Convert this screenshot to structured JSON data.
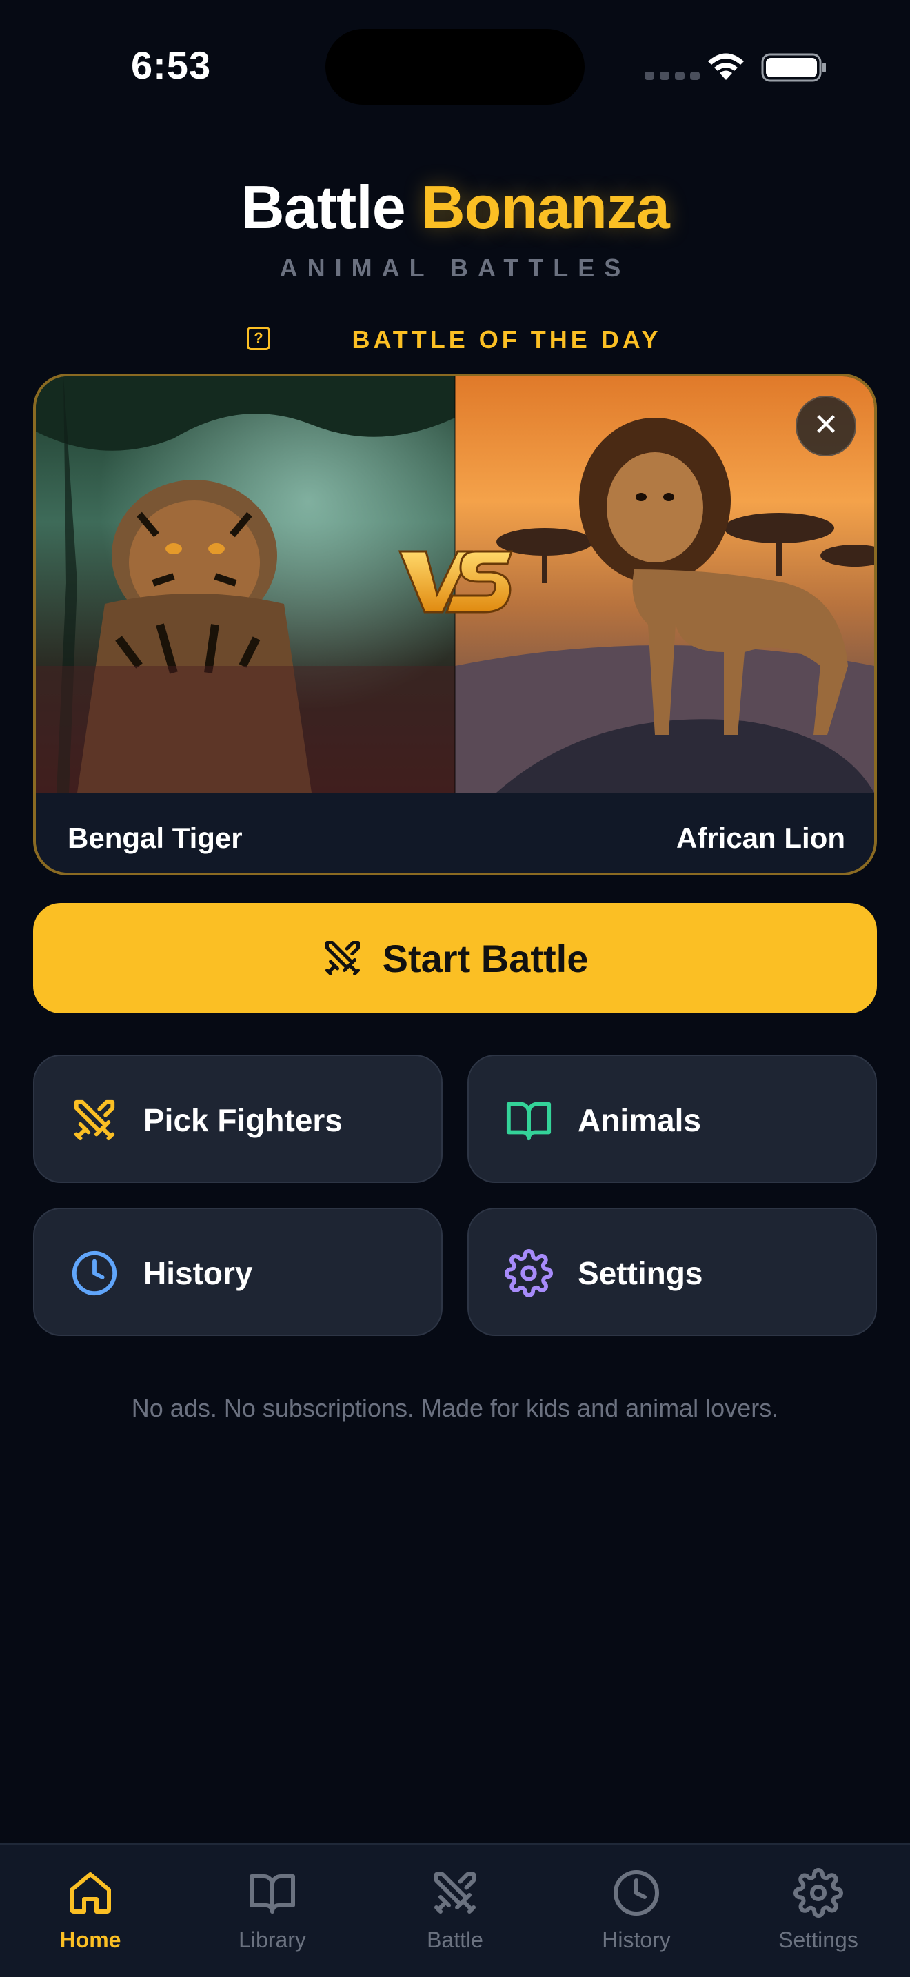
{
  "status_bar": {
    "time": "6:53"
  },
  "header": {
    "title_part1": "Battle",
    "title_part2": "Bonanza",
    "subtitle": "ANIMAL BATTLES"
  },
  "battle_of_day": {
    "label": "BATTLE OF THE DAY",
    "help_icon": "question-icon",
    "fighter_left": {
      "name": "Bengal Tiger",
      "image": "tiger-photo"
    },
    "fighter_right": {
      "name": "African Lion",
      "image": "lion-photo"
    },
    "vs_text": "VS"
  },
  "start_button": {
    "label": "Start Battle",
    "icon": "crossed-swords-icon"
  },
  "tiles": [
    {
      "label": "Pick Fighters",
      "icon": "crossed-swords-icon",
      "color": "#fbbf24"
    },
    {
      "label": "Animals",
      "icon": "book-icon",
      "color": "#34d399"
    },
    {
      "label": "History",
      "icon": "clock-icon",
      "color": "#60a5fa"
    },
    {
      "label": "Settings",
      "icon": "gear-icon",
      "color": "#a78bfa"
    }
  ],
  "footer_note": "No ads. No subscriptions. Made for kids and animal lovers.",
  "tab_bar": {
    "active": "Home",
    "items": [
      {
        "label": "Home",
        "icon": "home-icon"
      },
      {
        "label": "Library",
        "icon": "book-icon"
      },
      {
        "label": "Battle",
        "icon": "crossed-swords-icon"
      },
      {
        "label": "History",
        "icon": "clock-icon"
      },
      {
        "label": "Settings",
        "icon": "gear-icon"
      }
    ]
  },
  "colors": {
    "accent": "#fbbf24",
    "background": "#060a14",
    "tile": "#1e2533"
  }
}
